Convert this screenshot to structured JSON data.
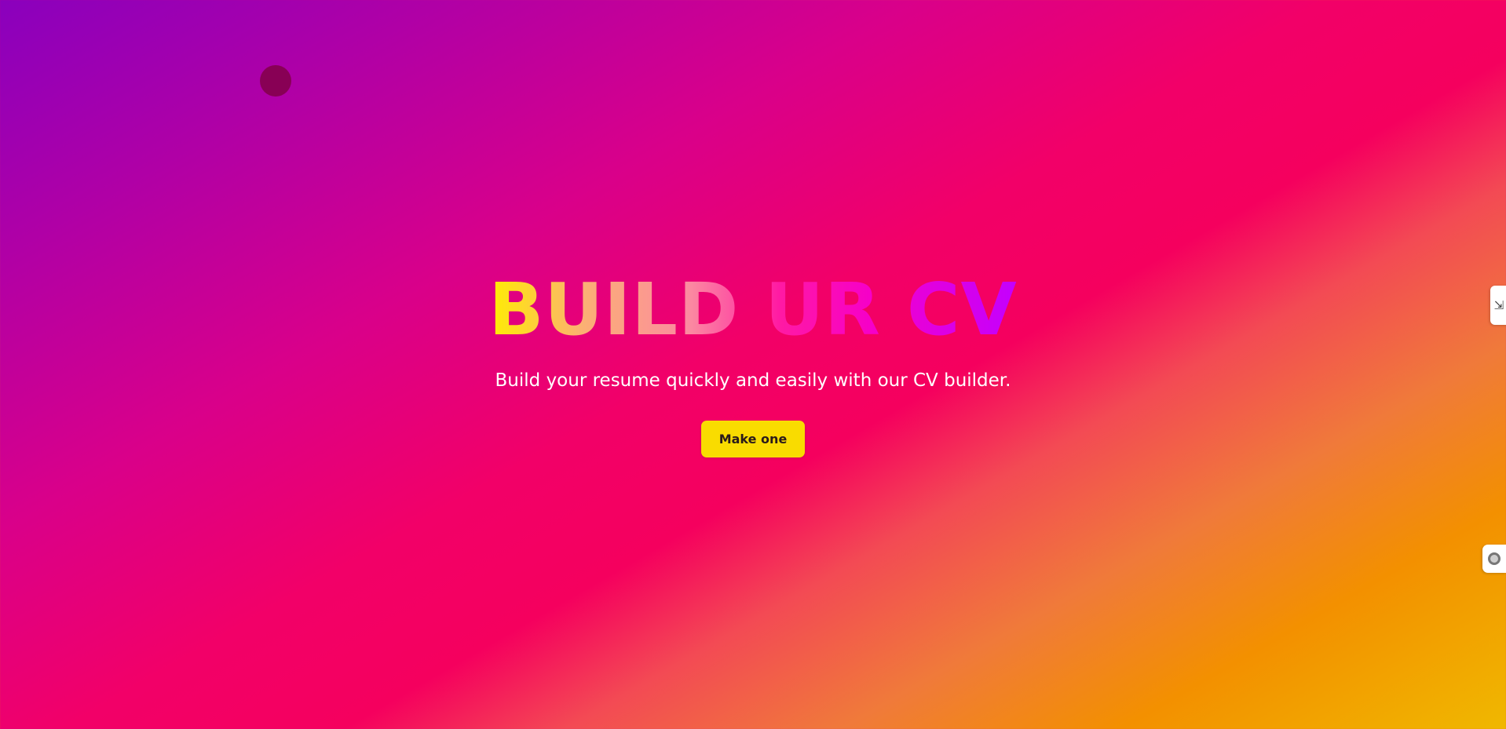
{
  "hero": {
    "title": "BUILD UR CV",
    "subtitle": "Build your resume quickly and easily with our CV builder.",
    "cta_label": "Make one"
  },
  "colors": {
    "button": "#f9dc00",
    "dot": "#880055",
    "title_gradient": [
      "#ffee00",
      "#fbb074",
      "#fb8aa1",
      "#ff1aa3",
      "#f600c8",
      "#c300ff"
    ]
  },
  "side_widgets": {
    "tab1_icon": "resize-icon",
    "tab2_icon": "ring-icon"
  }
}
